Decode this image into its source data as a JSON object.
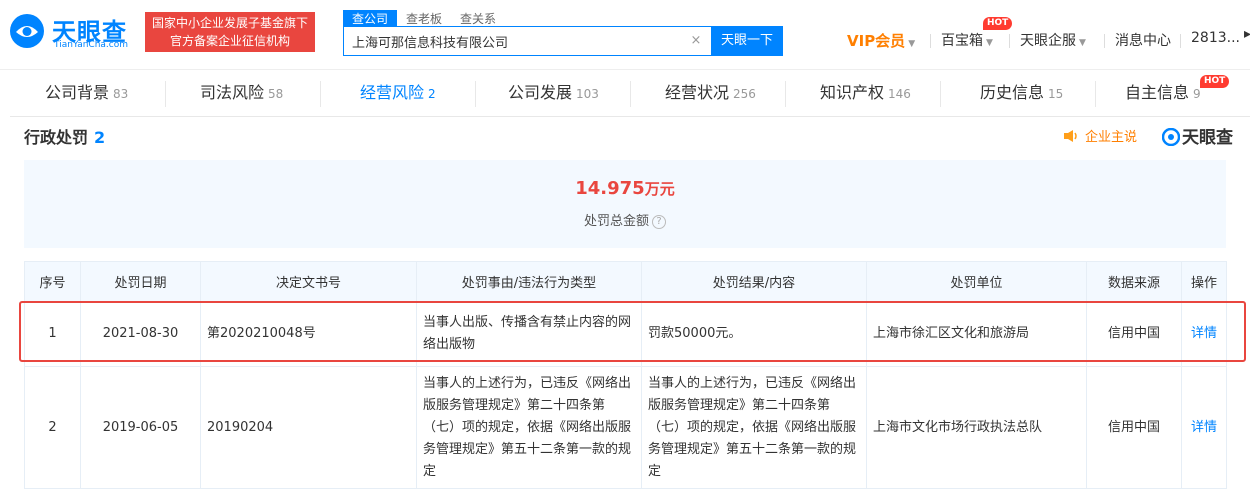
{
  "header": {
    "logo_text": "天眼查",
    "logo_sub": "TianYanCha.com",
    "banner_line1": "国家中小企业发展子基金旗下",
    "banner_line2": "官方备案企业征信机构",
    "search_tabs": [
      "查公司",
      "查老板",
      "查关系"
    ],
    "search_value": "上海可那信息科技有限公司",
    "search_button": "天眼一下",
    "clear_icon": "×",
    "nav": {
      "vip": "VIP会员",
      "baobao": "百宝箱",
      "hot": "HOT",
      "qifu": "天眼企服",
      "messages": "消息中心",
      "user": "2813..."
    }
  },
  "tabs": [
    {
      "label": "公司背景",
      "count": "83"
    },
    {
      "label": "司法风险",
      "count": "58"
    },
    {
      "label": "经营风险",
      "count": "2"
    },
    {
      "label": "公司发展",
      "count": "103"
    },
    {
      "label": "经营状况",
      "count": "256"
    },
    {
      "label": "知识产权",
      "count": "146"
    },
    {
      "label": "历史信息",
      "count": "15"
    },
    {
      "label": "自主信息",
      "count": "9"
    }
  ],
  "tabs_hot": "HOT",
  "section": {
    "title": "行政处罚",
    "count": "2",
    "sponsor": "企业主说",
    "brand": "天眼查"
  },
  "summary": {
    "amount": "14.975",
    "unit": "万元",
    "label": "处罚总金额",
    "help_icon": "?"
  },
  "table": {
    "headers": [
      "序号",
      "处罚日期",
      "决定文书号",
      "处罚事由/违法行为类型",
      "处罚结果/内容",
      "处罚单位",
      "数据来源",
      "操作"
    ],
    "rows": [
      {
        "index": "1",
        "date": "2021-08-30",
        "doc_no": "第2020210048号",
        "reason": "当事人出版、传播含有禁止内容的网络出版物",
        "result": "罚款50000元。",
        "authority": "上海市徐汇区文化和旅游局",
        "source": "信用中国",
        "action": "详情"
      },
      {
        "index": "2",
        "date": "2019-06-05",
        "doc_no": "20190204",
        "reason": "当事人的上述行为，已违反《网络出版服务管理规定》第二十四条第（七）项的规定，依据《网络出版服务管理规定》第五十二条第一款的规定",
        "result": "当事人的上述行为，已违反《网络出版服务管理规定》第二十四条第（七）项的规定，依据《网络出版服务管理规定》第五十二条第一款的规定",
        "authority": "上海市文化市场行政执法总队",
        "source": "信用中国",
        "action": "详情"
      }
    ]
  },
  "colors": {
    "brand_blue": "#0084ff",
    "alert_red": "#e9463f",
    "vip_orange": "#ff7f00"
  }
}
